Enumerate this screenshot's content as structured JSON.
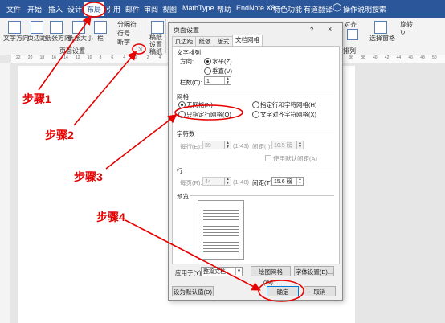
{
  "menu": {
    "tabs": [
      "文件",
      "开始",
      "插入",
      "设计",
      "布局",
      "引用",
      "邮件",
      "审阅",
      "视图",
      "MathType",
      "帮助",
      "EndNote X8",
      "特色功能",
      "有道翻译",
      "操作说明搜索"
    ],
    "active": "布局"
  },
  "ribbon": {
    "text_direction": "文字方向",
    "margins": "页边距",
    "orientation": "纸张方向",
    "size": "纸张大小",
    "columns": "栏",
    "breaks": "分隔符",
    "line_numbers": "行号",
    "hyphenation": "断字",
    "group_page_setup": "页面设置",
    "draft_settings_a": "稿纸",
    "draft_settings_b": "设置",
    "draft_group": "稿纸",
    "bring_forward": "对齐",
    "group_arrange": "排列",
    "select_pane_a": "选择窗格",
    "rotate": "旋转"
  },
  "ruler": {
    "marks": [
      "22",
      "20",
      "18",
      "16",
      "14",
      "12",
      "10",
      "8",
      "6",
      "4",
      "2",
      "2",
      "4",
      "6",
      "8",
      "10",
      "12",
      "14",
      "16",
      "18",
      "20",
      "22",
      "24",
      "26",
      "28",
      "30",
      "32",
      "34",
      "36",
      "38",
      "40",
      "42",
      "44",
      "46",
      "48",
      "50"
    ]
  },
  "dialog": {
    "title": "页面设置",
    "help": "?",
    "close": "×",
    "tabs": [
      "页边距",
      "纸张",
      "版式",
      "文档网格"
    ],
    "text_direction": {
      "section": "文字排列",
      "direction_label": "方向:",
      "horizontal": "水平(Z)",
      "vertical": "垂直(V)",
      "columns_label": "栏数(C):",
      "columns_value": "1"
    },
    "grid": {
      "section": "网格",
      "none": "无网格(N)",
      "lines_chars": "指定行和字符网格(H)",
      "lines_only": "只指定行网格(O)",
      "snap_chars": "文字对齐字符网格(X)"
    },
    "chars": {
      "section": "字符数",
      "per_line_label": "每行(E):",
      "per_line_value": "39",
      "per_line_range": "(1-43)",
      "pitch_label": "间距(I):",
      "pitch_value": "10.5 磅",
      "default_pitch": "使用默认间距(A)"
    },
    "lines": {
      "section": "行",
      "per_page_label": "每页(R):",
      "per_page_value": "44",
      "per_page_range": "(1-48)",
      "pitch_label": "间距(T):",
      "pitch_value": "15.6 磅"
    },
    "preview": {
      "section": "预览"
    },
    "apply_label": "应用于(Y):",
    "apply_value": "整篇文档",
    "draw_grid": "绘图网格(W)...",
    "font_settings": "字体设置(E)...",
    "set_default": "设为默认值(D)",
    "ok": "确定",
    "cancel": "取消"
  },
  "annotations": {
    "step1": "步骤1",
    "step2": "步骤2",
    "step3": "步骤3",
    "step4": "步骤4",
    "color": "#e60000"
  }
}
